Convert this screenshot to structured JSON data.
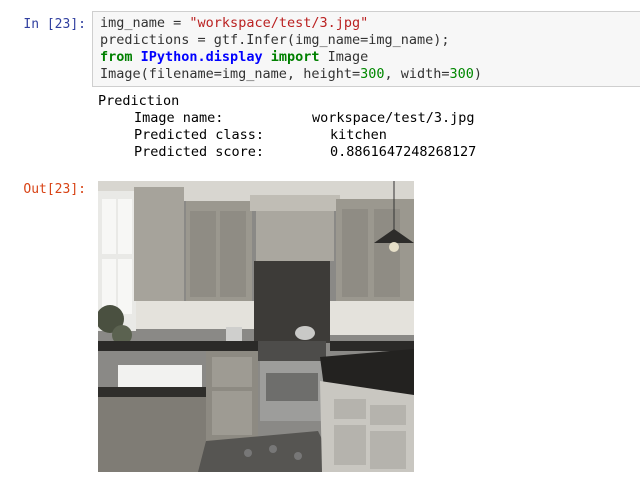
{
  "cell": {
    "in_prompt": "In [23]:",
    "out_prompt": "Out[23]:",
    "code": {
      "line1": {
        "var": "img_name",
        "op": " = ",
        "str": "\"workspace/test/3.jpg\""
      },
      "line2": {
        "text": "predictions = gtf.Infer(img_name=img_name);"
      },
      "line3": {
        "from": "from",
        "module": "IPython.display",
        "import": "import",
        "name": "Image"
      },
      "line4": {
        "pre": "Image(filename=img_name, height=",
        "n1": "300",
        "mid": ", width=",
        "n2": "300",
        "post": ")"
      }
    },
    "stdout": {
      "heading": "Prediction",
      "rows": [
        {
          "label": "Image name:",
          "value": "workspace/test/3.jpg"
        },
        {
          "label": "Predicted class:",
          "value": "kitchen"
        },
        {
          "label": "Predicted score:",
          "value": "0.8861647248268127"
        }
      ]
    }
  },
  "colors": {
    "in_prompt": "#303f9f",
    "out_prompt": "#d84315",
    "keyword": "#008000",
    "module": "#0000ff",
    "string": "#ba2121",
    "cell_background": "#f7f7f7"
  }
}
